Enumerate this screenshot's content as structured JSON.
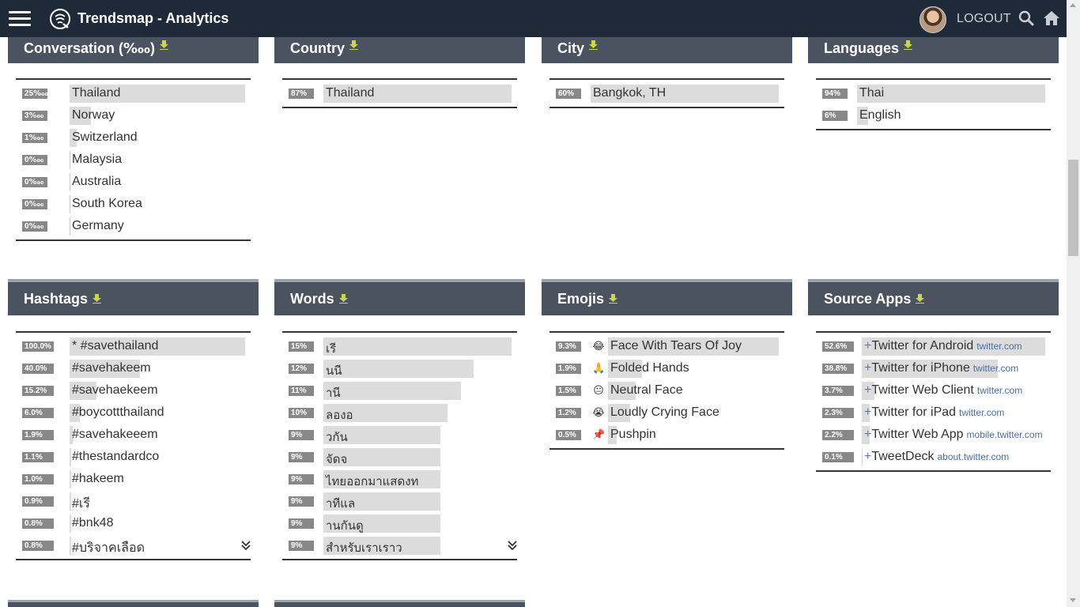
{
  "header": {
    "title": "Trendsmap - Analytics",
    "logout_label": "LOGOUT"
  },
  "panels": {
    "conversation": {
      "title": "Conversation (‱)",
      "rows": [
        {
          "badge": "25‱",
          "label": "Thailand",
          "value": 100
        },
        {
          "badge": "3‱",
          "label": "Norway",
          "value": 12
        },
        {
          "badge": "1‱",
          "label": "Switzerland",
          "value": 4
        },
        {
          "badge": "0‱",
          "label": "Malaysia",
          "value": 0
        },
        {
          "badge": "0‱",
          "label": "Australia",
          "value": 0
        },
        {
          "badge": "0‱",
          "label": "South Korea",
          "value": 0
        },
        {
          "badge": "0‱",
          "label": "Germany",
          "value": 0
        }
      ]
    },
    "country": {
      "title": "Country",
      "rows": [
        {
          "badge": "87%",
          "label": "Thailand",
          "value": 100
        }
      ]
    },
    "city": {
      "title": "City",
      "rows": [
        {
          "badge": "60%",
          "label": "Bangkok, TH",
          "value": 100
        }
      ]
    },
    "languages": {
      "title": "Languages",
      "rows": [
        {
          "badge": "94%",
          "label": "Thai",
          "value": 100
        },
        {
          "badge": "6%",
          "label": "English",
          "value": 6
        }
      ]
    },
    "hashtags": {
      "title": "Hashtags",
      "rows": [
        {
          "badge": "100.0%",
          "label": "* #savethailand",
          "value": 100
        },
        {
          "badge": "40.0%",
          "label": "#savehakeem",
          "value": 40
        },
        {
          "badge": "15.2%",
          "label": "#savehaekeem",
          "value": 15.2
        },
        {
          "badge": "6.0%",
          "label": "#boycottthailand",
          "value": 6
        },
        {
          "badge": "1.9%",
          "label": "#savehakeeem",
          "value": 1.9
        },
        {
          "badge": "1.1%",
          "label": "#thestandardco",
          "value": 1.1
        },
        {
          "badge": "1.0%",
          "label": "#hakeem",
          "value": 1
        },
        {
          "badge": "0.9%",
          "label": "#เรี",
          "value": 0.9
        },
        {
          "badge": "0.8%",
          "label": "#bnk48",
          "value": 0.8
        },
        {
          "badge": "0.8%",
          "label": "#บริจาคเลือด",
          "value": 0.8
        }
      ]
    },
    "words": {
      "title": "Words",
      "rows": [
        {
          "badge": "15%",
          "label": "เรี",
          "value": 100
        },
        {
          "badge": "12%",
          "label": "นนี",
          "value": 80
        },
        {
          "badge": "11%",
          "label": "านี",
          "value": 73
        },
        {
          "badge": "10%",
          "label": "ลองอ",
          "value": 66
        },
        {
          "badge": "9%",
          "label": "วกัน",
          "value": 62
        },
        {
          "badge": "9%",
          "label": "จัดจ",
          "value": 62
        },
        {
          "badge": "9%",
          "label": "ไทยออกมาแสดงท",
          "value": 62
        },
        {
          "badge": "9%",
          "label": "าทีแล",
          "value": 62
        },
        {
          "badge": "9%",
          "label": "านกันดู",
          "value": 62
        },
        {
          "badge": "9%",
          "label": "สำหรับเราเราว",
          "value": 62
        }
      ]
    },
    "emojis": {
      "title": "Emojis",
      "rows": [
        {
          "badge": "9.3%",
          "icon": "😂",
          "label": "Face With Tears Of Joy",
          "value": 100
        },
        {
          "badge": "1.9%",
          "icon": "🙏",
          "label": "Folded Hands",
          "value": 20
        },
        {
          "badge": "1.5%",
          "icon": "😐",
          "label": "Neutral Face",
          "value": 16
        },
        {
          "badge": "1.2%",
          "icon": "😭",
          "label": "Loudly Crying Face",
          "value": 13
        },
        {
          "badge": "0.5%",
          "icon": "📌",
          "label": "Pushpin",
          "value": 5
        }
      ]
    },
    "sources": {
      "title": "Source Apps",
      "rows": [
        {
          "badge": "52.6%",
          "label": "Twitter for Android",
          "link": "twitter.com",
          "value": 100
        },
        {
          "badge": "38.8%",
          "label": "Twitter for iPhone",
          "link": "twitter.com",
          "value": 74
        },
        {
          "badge": "3.7%",
          "label": "Twitter Web Client",
          "link": "twitter.com",
          "value": 7
        },
        {
          "badge": "2.3%",
          "label": "Twitter for iPad",
          "link": "twitter.com",
          "value": 4.4
        },
        {
          "badge": "2.2%",
          "label": "Twitter Web App",
          "link": "mobile.twitter.com",
          "value": 4.2
        },
        {
          "badge": "0.1%",
          "label": "TweetDeck",
          "link": "about.twitter.com",
          "value": 0.2
        }
      ]
    }
  },
  "icons": {
    "menu": "hamburger-menu-icon",
    "logo": "trendsmap-logo-icon",
    "download": "download-icon",
    "search": "search-icon",
    "home": "home-icon",
    "expand": "double-chevron-down-icon"
  },
  "colors": {
    "topbar": "#1f2a38",
    "panel_header": "#4b5360",
    "download_icon": "#c8d84a",
    "bar": "#dcdcdc",
    "badge": "#888888"
  }
}
